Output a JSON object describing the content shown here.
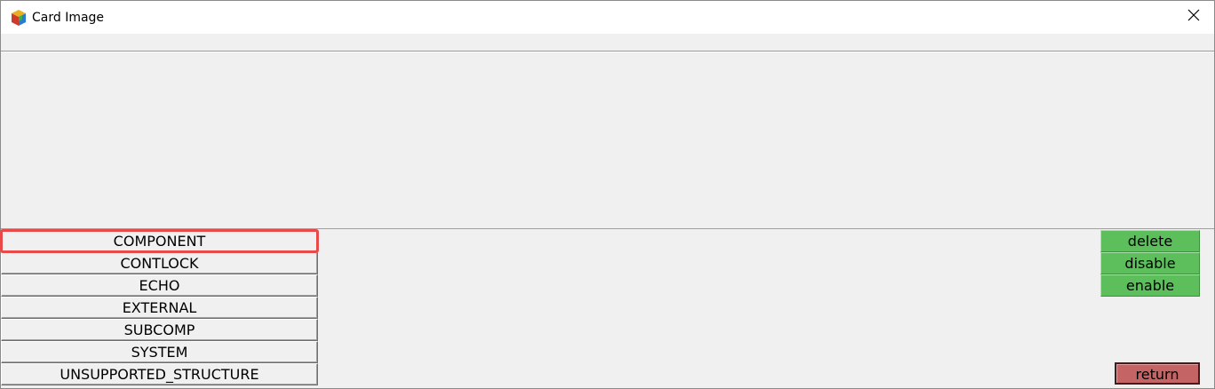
{
  "window": {
    "title": "Card Image",
    "close_glyph": "✕"
  },
  "icons": {
    "app": "app-cube-icon",
    "close": "close-icon"
  },
  "list": {
    "items": [
      {
        "label": "COMPONENT",
        "selected": true
      },
      {
        "label": "CONTLOCK",
        "selected": false
      },
      {
        "label": "ECHO",
        "selected": false
      },
      {
        "label": "EXTERNAL",
        "selected": false
      },
      {
        "label": "SUBCOMP",
        "selected": false
      },
      {
        "label": "SYSTEM",
        "selected": false
      },
      {
        "label": "UNSUPPORTED_STRUCTURE",
        "selected": false
      }
    ]
  },
  "actions": {
    "delete_label": "delete",
    "disable_label": "disable",
    "enable_label": "enable",
    "return_label": "return"
  },
  "colors": {
    "action_green": "#5cbf5c",
    "return_red": "#c46464",
    "selection_outline": "#e84a4a",
    "background": "#f0f0f0"
  }
}
